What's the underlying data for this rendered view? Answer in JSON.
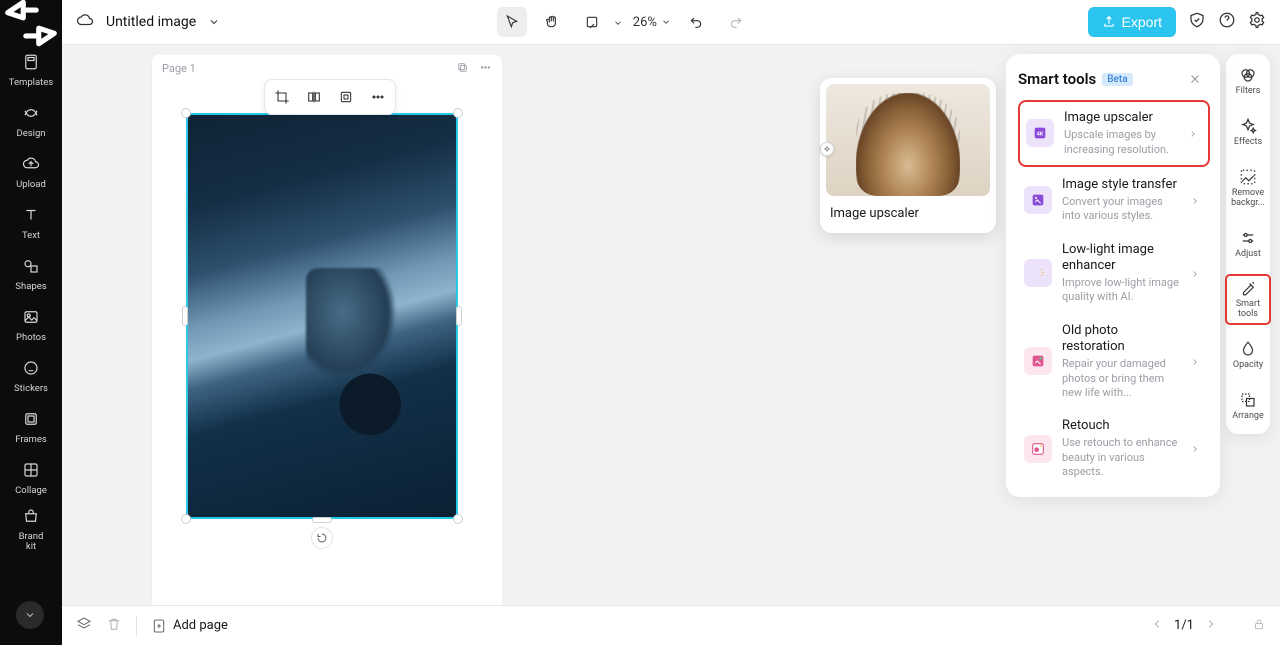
{
  "header": {
    "title": "Untitled image",
    "zoom": "26%",
    "export_label": "Export"
  },
  "left_nav": {
    "items": [
      {
        "label": "Templates"
      },
      {
        "label": "Design"
      },
      {
        "label": "Upload"
      },
      {
        "label": "Text"
      },
      {
        "label": "Shapes"
      },
      {
        "label": "Photos"
      },
      {
        "label": "Stickers"
      },
      {
        "label": "Frames"
      },
      {
        "label": "Collage"
      },
      {
        "label": "Brand\nkit"
      }
    ]
  },
  "right_rail": {
    "items": [
      {
        "label": "Filters"
      },
      {
        "label": "Effects"
      },
      {
        "label": "Remove\nbackgr..."
      },
      {
        "label": "Adjust"
      },
      {
        "label": "Smart\ntools"
      },
      {
        "label": "Opacity"
      },
      {
        "label": "Arrange"
      }
    ]
  },
  "page": {
    "label": "Page 1"
  },
  "smart_panel": {
    "title": "Smart tools",
    "badge": "Beta",
    "items": [
      {
        "title": "Image upscaler",
        "desc": "Upscale images by increasing resolution."
      },
      {
        "title": "Image style transfer",
        "desc": "Convert your images into various styles."
      },
      {
        "title": "Low-light image enhancer",
        "desc": "Improve low-light image quality with AI."
      },
      {
        "title": "Old photo restoration",
        "desc": "Repair your damaged photos or bring them new life with..."
      },
      {
        "title": "Retouch",
        "desc": "Use retouch to enhance beauty in various aspects."
      }
    ]
  },
  "preview": {
    "caption": "Image upscaler"
  },
  "bottombar": {
    "add_page": "Add page",
    "pager": "1/1"
  }
}
